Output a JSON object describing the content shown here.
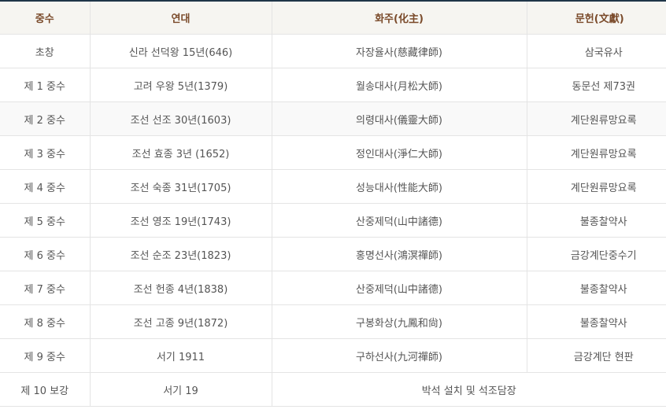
{
  "table": {
    "headers": [
      "중수",
      "연대",
      "화주(化主)",
      "문헌(文獻)"
    ],
    "rows": [
      [
        "초창",
        "신라 선덕왕 15년(646)",
        "자장율사(慈藏律師)",
        "삼국유사"
      ],
      [
        "제 1 중수",
        "고려 우왕 5년(1379)",
        "월송대사(月松大師)",
        "동문선 제73권"
      ],
      [
        "제 2 중수",
        "조선 선조 30년(1603)",
        "의령대사(儀靈大師)",
        "계단원류망요록"
      ],
      [
        "제 3 중수",
        "조선 효종 3년 (1652)",
        "정인대사(淨仁大師)",
        "계단원류망요록"
      ],
      [
        "제 4 중수",
        "조선 숙종 31년(1705)",
        "성능대사(性能大師)",
        "계단원류망요록"
      ],
      [
        "제 5 중수",
        "조선 영조 19년(1743)",
        "산중제덕(山中諸德)",
        "불종찰약사"
      ],
      [
        "제 6 중수",
        "조선 순조 23년(1823)",
        "홍명선사(鴻溟禪師)",
        "금강계단중수기"
      ],
      [
        "제 7 중수",
        "조선 헌종 4년(1838)",
        "산중제덕(山中諸德)",
        "불종찰약사"
      ],
      [
        "제 8 중수",
        "조선 고종 9년(1872)",
        "구봉화상(九鳳和尙)",
        "불종찰약사"
      ],
      [
        "제 9 중수",
        "서기 1911",
        "구하선사(九河禪師)",
        "금강계단 현판"
      ]
    ],
    "last_row": {
      "c1": "제 10 보강",
      "c2": "서기 19",
      "merged": "박석 설치 및 석조담장"
    }
  }
}
